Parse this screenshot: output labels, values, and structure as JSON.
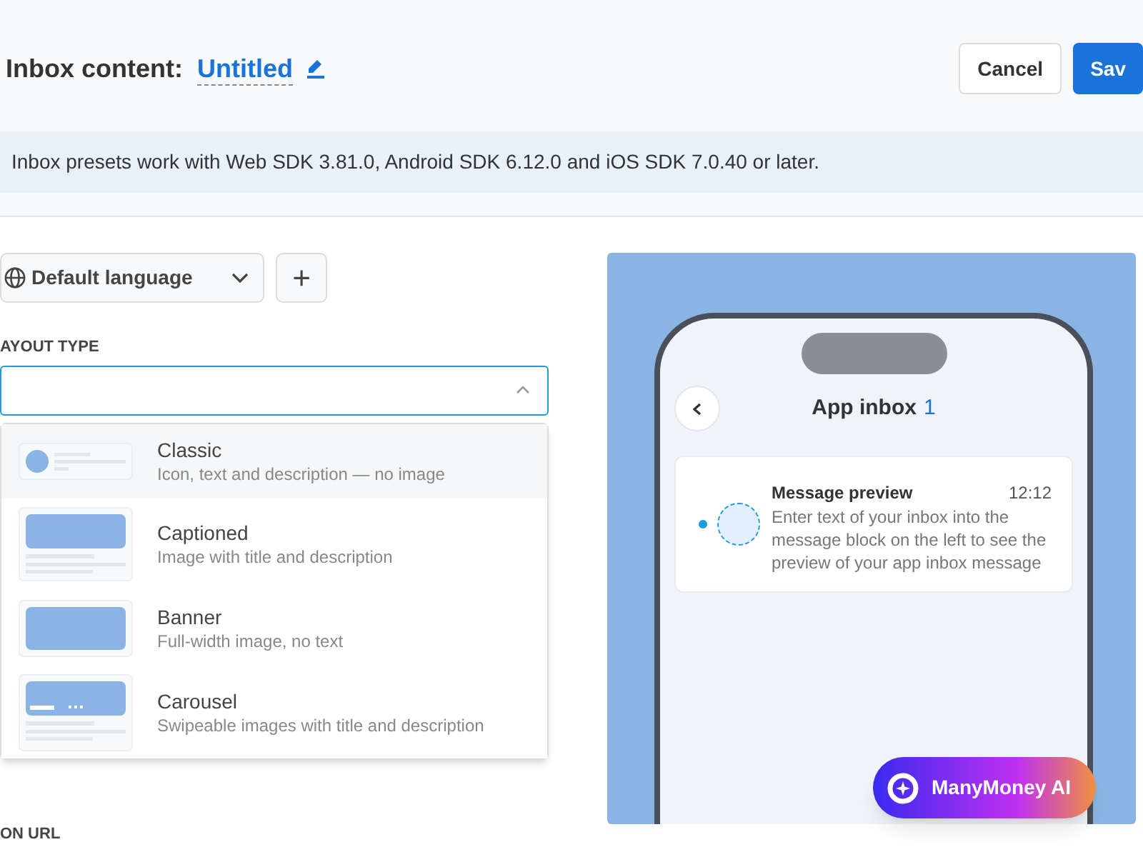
{
  "header": {
    "title": "Inbox content:",
    "name": "Untitled",
    "buttons": [
      {
        "label": "Cancel",
        "kind": "secondary"
      },
      {
        "label": "Sav",
        "kind": "primary"
      }
    ]
  },
  "notice": "Inbox presets work with Web SDK 3.81.0, Android SDK 6.12.0 and iOS SDK 7.0.40 or later.",
  "language_select": {
    "value": "Default language"
  },
  "add_button": {
    "label": "+"
  },
  "layout_type": {
    "label": "AYOUT TYPE",
    "expanded": true,
    "options": [
      {
        "kind": "classic",
        "title": "Classic",
        "description": "Icon, text and description — no image",
        "selected": true
      },
      {
        "kind": "captioned",
        "title": "Captioned",
        "description": "Image with title and description",
        "selected": false
      },
      {
        "kind": "banner",
        "title": "Banner",
        "description": "Full-width image, no text",
        "selected": false
      },
      {
        "kind": "carousel",
        "title": "Carousel",
        "description": "Swipeable images with title and description",
        "selected": false
      }
    ]
  },
  "next_label": "ON URL",
  "preview": {
    "title": "App inbox",
    "count": "1",
    "message": {
      "title": "Message preview",
      "time": "12:12",
      "text": "Enter text of your inbox into the message block on the left to see the preview of your app inbox message",
      "unread": true
    }
  },
  "assistant_button": {
    "label": "ManyMoney AI"
  }
}
